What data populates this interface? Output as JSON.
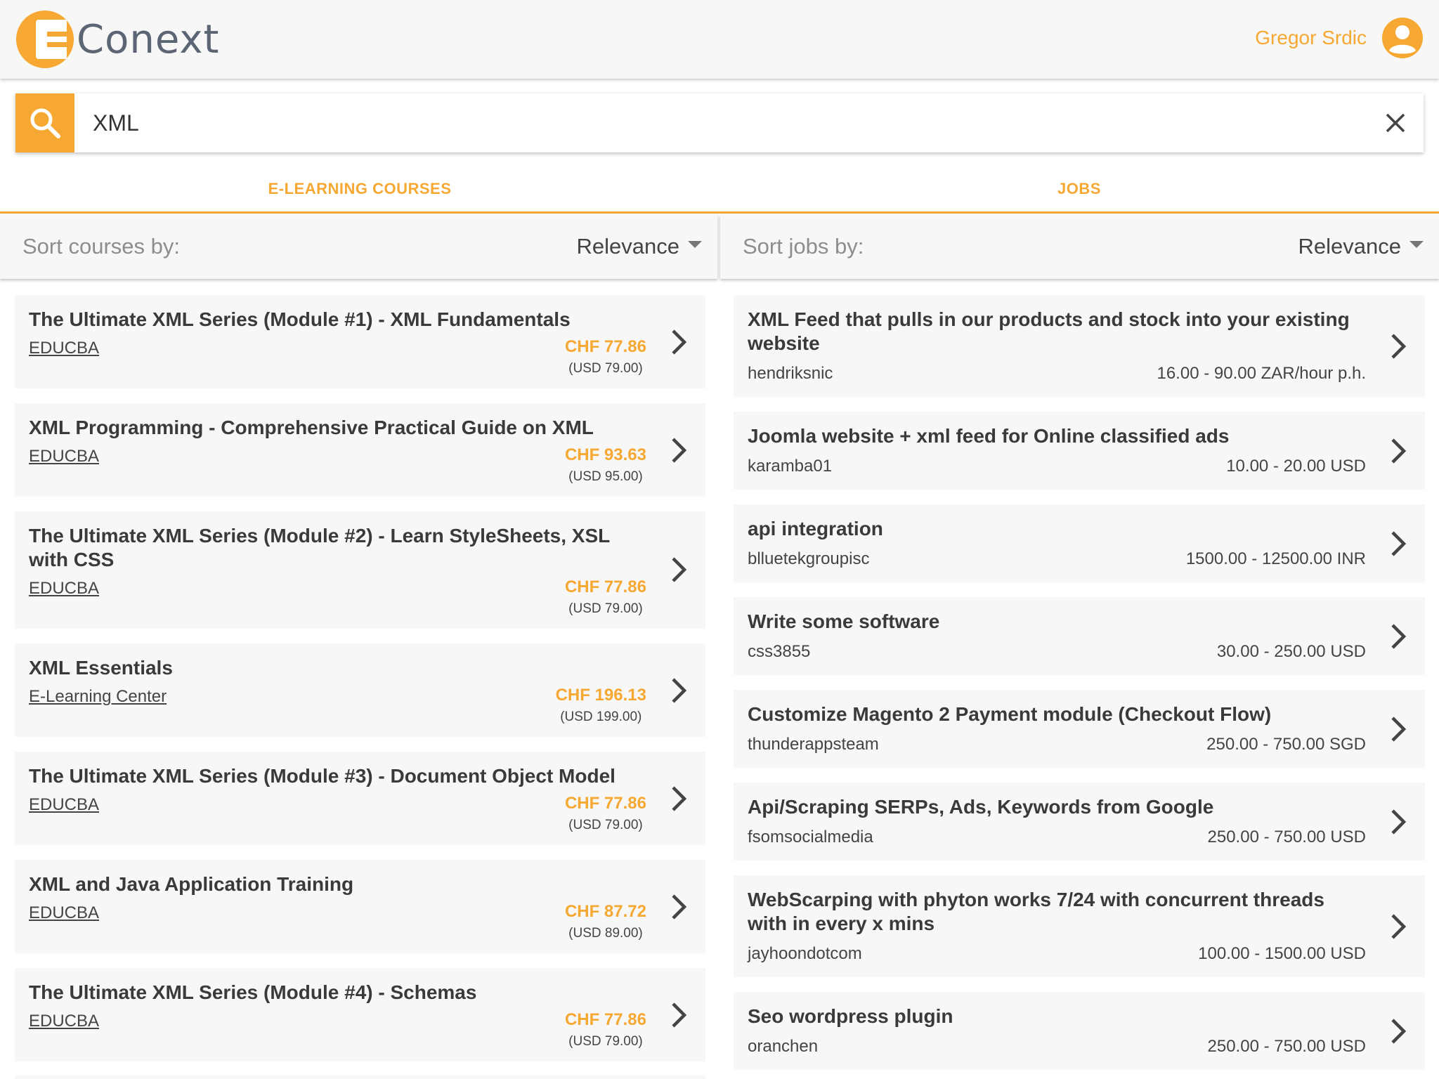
{
  "brand": {
    "name": "Conext",
    "colors": {
      "accent": "#f6a832",
      "text": "#333333",
      "card": "#f7f7f7"
    }
  },
  "user": {
    "name": "Gregor Srdic",
    "icon": "account-circle-icon"
  },
  "search": {
    "value": "XML",
    "icon": "search-icon",
    "clear_icon": "close-icon"
  },
  "tabs": [
    {
      "label": "E-LEARNING COURSES"
    },
    {
      "label": "JOBS"
    }
  ],
  "courses": {
    "sort_label": "Sort courses by:",
    "sort_value": "Relevance",
    "items": [
      {
        "title": "The Ultimate XML Series (Module #1) - XML Fundamentals",
        "provider": "EDUCBA",
        "price_chf": "CHF 77.86",
        "price_usd": "(USD 79.00)"
      },
      {
        "title": "XML Programming - Comprehensive Practical Guide on XML",
        "provider": "EDUCBA",
        "price_chf": "CHF 93.63",
        "price_usd": "(USD 95.00)"
      },
      {
        "title": "The Ultimate XML Series (Module #2) - Learn StyleSheets, XSL with CSS",
        "provider": "EDUCBA",
        "price_chf": "CHF 77.86",
        "price_usd": "(USD 79.00)"
      },
      {
        "title": "XML Essentials",
        "provider": "E-Learning Center",
        "price_chf": "CHF 196.13",
        "price_usd": "(USD 199.00)"
      },
      {
        "title": "The Ultimate XML Series (Module #3) - Document Object Model",
        "provider": "EDUCBA",
        "price_chf": "CHF 77.86",
        "price_usd": "(USD 79.00)"
      },
      {
        "title": "XML and Java Application Training",
        "provider": "EDUCBA",
        "price_chf": "CHF 87.72",
        "price_usd": "(USD 89.00)"
      },
      {
        "title": "The Ultimate XML Series (Module #4) - Schemas",
        "provider": "EDUCBA",
        "price_chf": "CHF 77.86",
        "price_usd": "(USD 79.00)"
      }
    ]
  },
  "jobs": {
    "sort_label": "Sort jobs by:",
    "sort_value": "Relevance",
    "items": [
      {
        "title": "XML Feed that pulls in our products and stock into your existing website",
        "user": "hendriksnic",
        "budget": "16.00 - 90.00 ZAR/hour p.h."
      },
      {
        "title": "Joomla website + xml feed for Online classified ads",
        "user": "karamba01",
        "budget": "10.00 - 20.00 USD"
      },
      {
        "title": "api integration",
        "user": "blluetekgroupisc",
        "budget": "1500.00 - 12500.00 INR"
      },
      {
        "title": "Write some software",
        "user": "css3855",
        "budget": "30.00 - 250.00 USD"
      },
      {
        "title": "Customize Magento 2 Payment module (Checkout Flow)",
        "user": "thunderappsteam",
        "budget": "250.00 - 750.00 SGD"
      },
      {
        "title": "Api/Scraping SERPs, Ads, Keywords from Google",
        "user": "fsomsocialmedia",
        "budget": "250.00 - 750.00 USD"
      },
      {
        "title": "WebScarping with phyton works 7/24 with concurrent threads with in every x mins",
        "user": "jayhoondotcom",
        "budget": "100.00 - 1500.00 USD"
      },
      {
        "title": "Seo wordpress plugin",
        "user": "oranchen",
        "budget": "250.00 - 750.00 USD"
      }
    ]
  }
}
